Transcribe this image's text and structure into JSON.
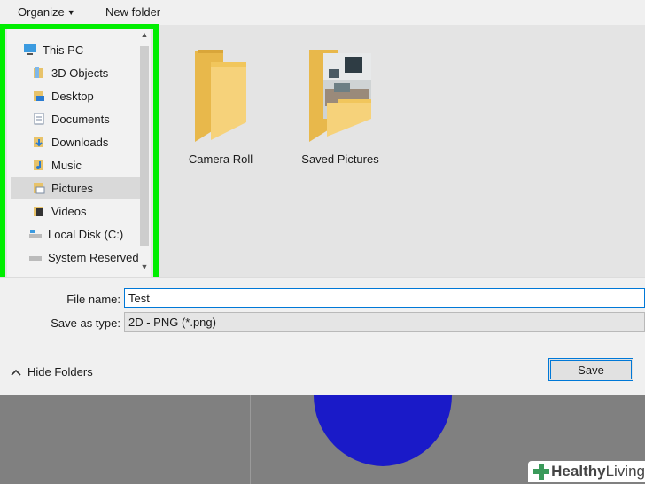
{
  "toolbar": {
    "organize": "Organize",
    "new_folder": "New folder"
  },
  "nav": {
    "items": [
      {
        "label": "This PC",
        "icon": "pc-icon"
      },
      {
        "label": "3D Objects",
        "icon": "3d-objects-icon"
      },
      {
        "label": "Desktop",
        "icon": "desktop-icon"
      },
      {
        "label": "Documents",
        "icon": "documents-icon"
      },
      {
        "label": "Downloads",
        "icon": "downloads-icon"
      },
      {
        "label": "Music",
        "icon": "music-icon"
      },
      {
        "label": "Pictures",
        "icon": "pictures-icon",
        "selected": true
      },
      {
        "label": "Videos",
        "icon": "videos-icon"
      },
      {
        "label": "Local Disk (C:)",
        "icon": "drive-icon"
      },
      {
        "label": "System Reserved",
        "icon": "drive-icon"
      }
    ]
  },
  "folders": [
    {
      "label": "Camera Roll",
      "icon": "folder-icon"
    },
    {
      "label": "Saved Pictures",
      "icon": "folder-with-photo-icon"
    }
  ],
  "form": {
    "file_name_label": "File name:",
    "file_name_value": "Test",
    "save_type_label": "Save as type:",
    "save_type_value": "2D - PNG (*.png)"
  },
  "footer": {
    "hide_folders": "Hide Folders",
    "save": "Save"
  },
  "watermark": {
    "bold": "Healthy",
    "light": " Living"
  },
  "colors": {
    "highlight": "#00ee00",
    "accent": "#0078d7",
    "circle": "#1a1ac8"
  }
}
